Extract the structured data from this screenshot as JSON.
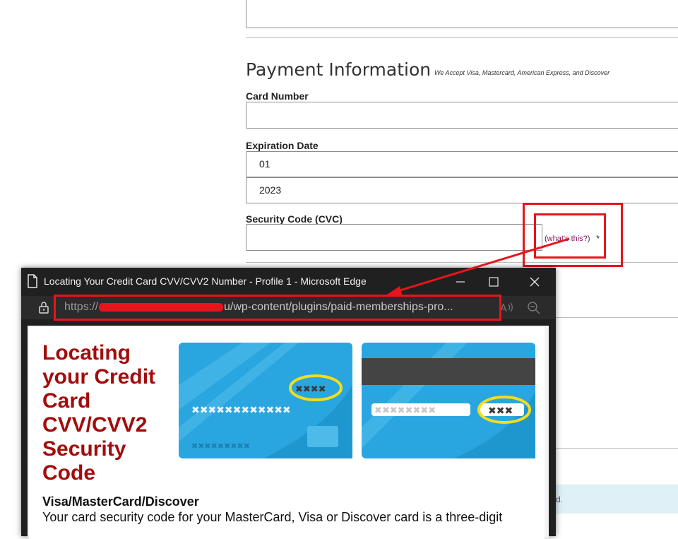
{
  "form": {
    "section_title": "Payment Information",
    "accept_note": "We Accept Visa, Mastercard, American Express, and Discover",
    "card_number_label": "Card Number",
    "expiration_label": "Expiration Date",
    "exp_month": "01",
    "exp_year": "2023",
    "cvc_label": "Security Code (CVC)",
    "whats_this_open": "(",
    "whats_this": "what's this?",
    "whats_this_close": ")",
    "required_mark": "*",
    "info_text": "d."
  },
  "popup": {
    "window_title": "Locating Your Credit Card CVV/CVV2 Number - Profile 1 - Microsoft Edge",
    "url_prefix": "https://",
    "url_suffix": "u/wp-content/plugins/paid-memberships-pro...",
    "page_title": "Locating your Credit Card CVV/CVV2 Security Code",
    "card_front_mask": "✖✖✖✖",
    "card_front_number": "✖✖✖✖✖✖✖✖✖✖✖✖",
    "card_front_small": "✖✖✖✖✖✖✖✖✖",
    "card_back_strip": "✖✖✖✖✖✖✖✖",
    "card_back_code": "✖✖✖",
    "subheading": "Visa/MasterCard/Discover",
    "body": "Your card security code for your MasterCard, Visa or Discover card is a three-digit"
  },
  "icons": {
    "doc": "document-icon",
    "minimize": "minimize-icon",
    "maximize": "maximize-icon",
    "close": "close-icon",
    "lock": "lock-icon",
    "read_aloud": "read-aloud-icon",
    "zoom": "zoom-out-icon"
  },
  "colors": {
    "annotation_red": "#e8141b",
    "heading_red": "#a30c0c",
    "card_blue": "#29a6df",
    "highlight_yellow": "#f4dd1d",
    "link": "#8b1a5c"
  }
}
